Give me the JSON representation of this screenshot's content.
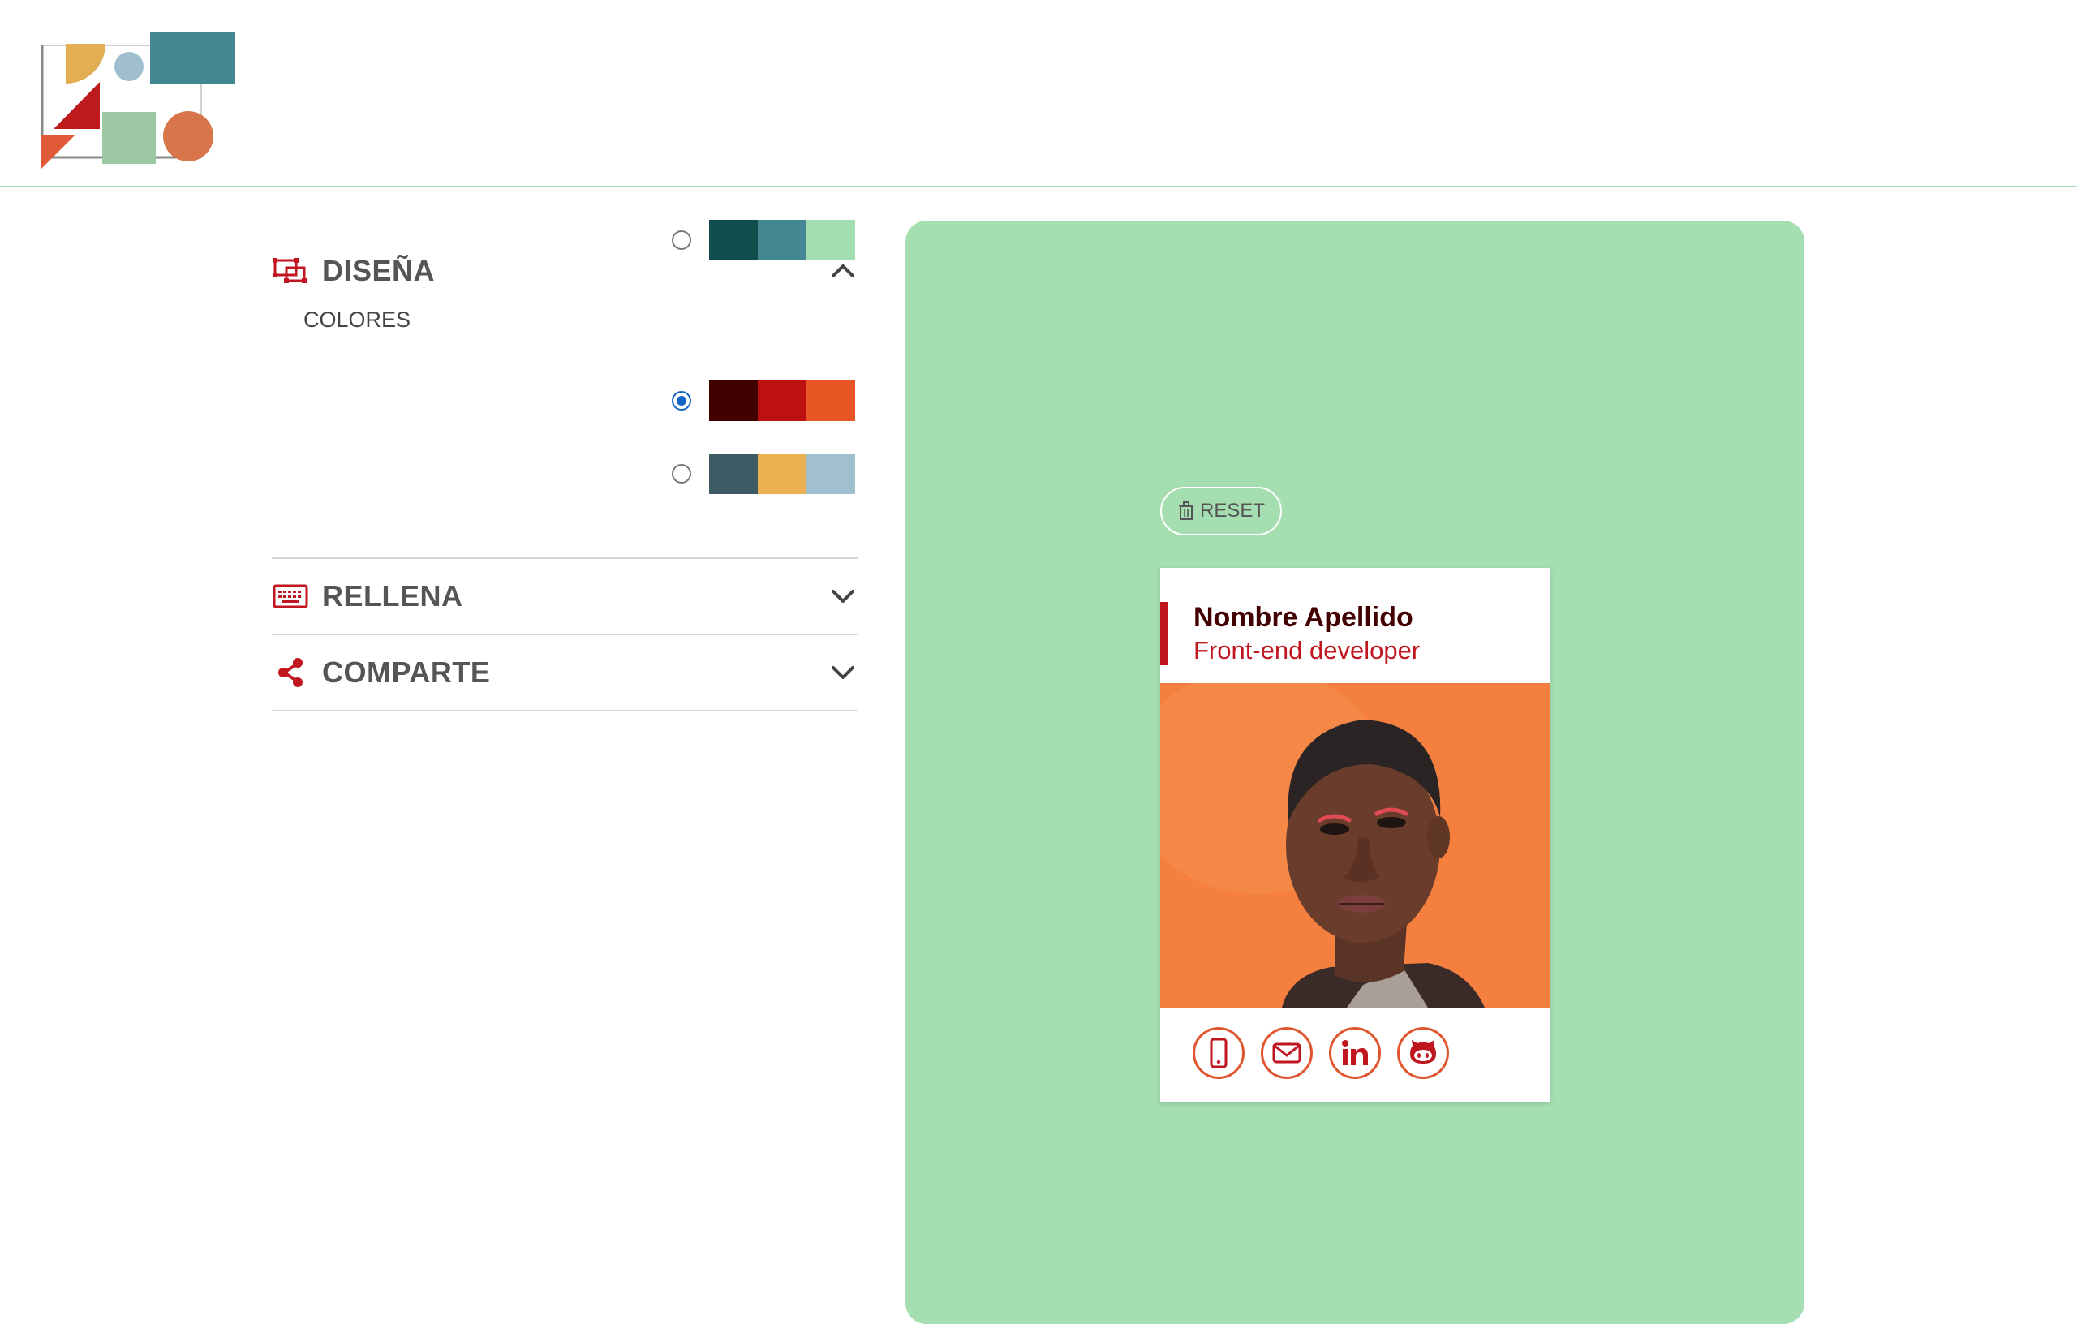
{
  "app": {
    "logo_icon": "geometric-shapes-logo"
  },
  "panel": {
    "design": {
      "title": "DISEÑA",
      "icon": "design-icon",
      "expanded": true,
      "colors_label": "COLORES",
      "palettes": [
        {
          "selected": false,
          "colors": [
            "#114e4e",
            "#438792",
            "#a2deaf"
          ]
        },
        {
          "selected": true,
          "colors": [
            "#420101",
            "#bd1010",
            "#e95626"
          ]
        },
        {
          "selected": false,
          "colors": [
            "#3e5b65",
            "#eab052",
            "#a0c0cf"
          ]
        }
      ]
    },
    "fill": {
      "title": "RELLENA",
      "icon": "keyboard-icon",
      "expanded": false
    },
    "share": {
      "title": "COMPARTE",
      "icon": "share-icon",
      "expanded": false
    }
  },
  "preview": {
    "reset_label": "RESET",
    "card": {
      "name": "Nombre Apellido",
      "job": "Front-end developer",
      "social": [
        "phone-icon",
        "email-icon",
        "linkedin-icon",
        "github-icon"
      ]
    }
  },
  "colors": {
    "header_border": "#a8dcb5",
    "preview_bg": "#a4deb1",
    "accent": "#c0161f",
    "name_color": "#420000",
    "social_border": "#e0552d"
  }
}
